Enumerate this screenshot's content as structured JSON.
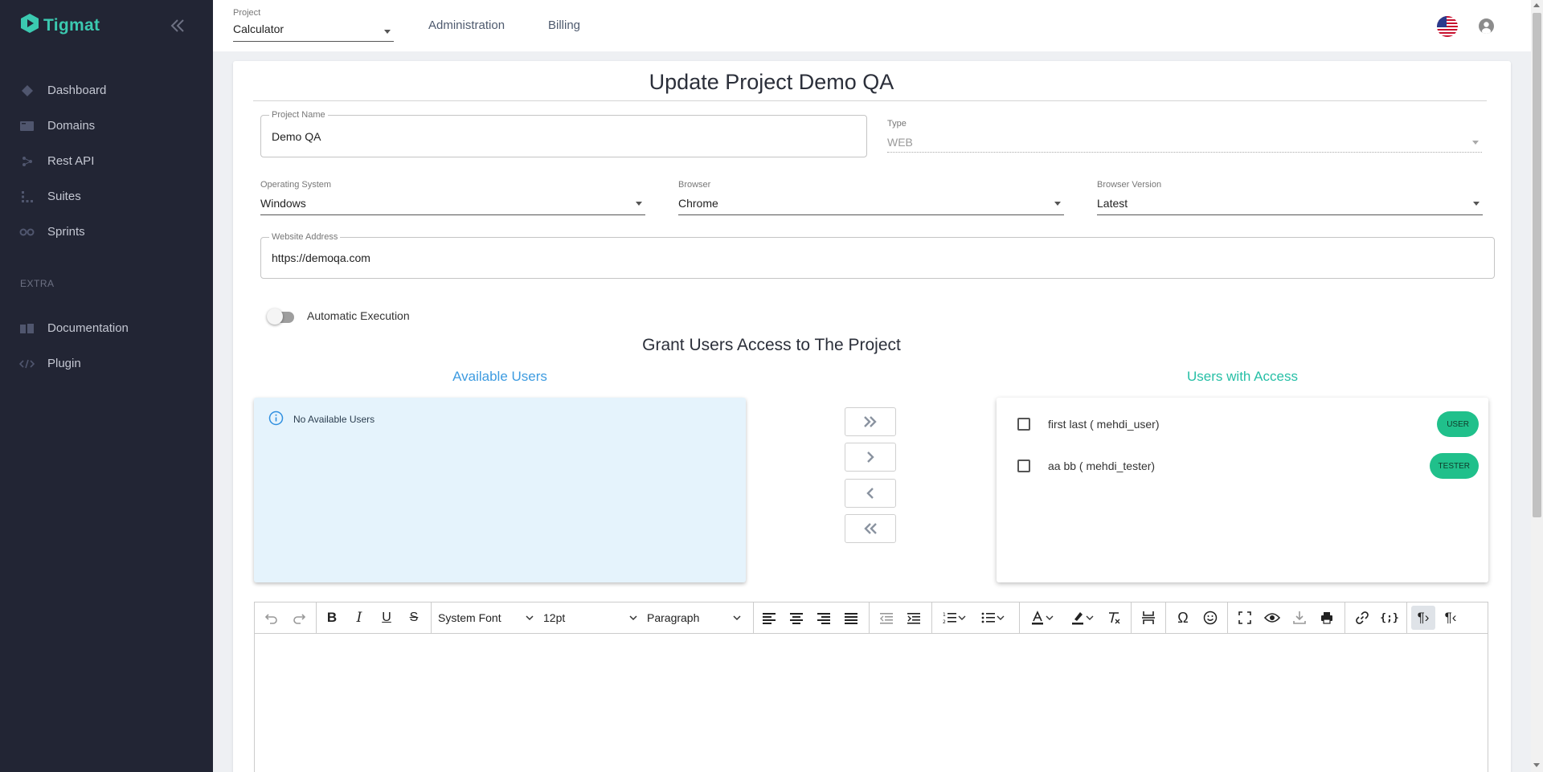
{
  "app": {
    "name": "Tigmat",
    "brand_color": "#3bc9b0"
  },
  "sidebar": {
    "items": [
      {
        "label": "Dashboard",
        "icon": "dashboard-icon"
      },
      {
        "label": "Domains",
        "icon": "domains-icon"
      },
      {
        "label": "Rest API",
        "icon": "rest-api-icon"
      },
      {
        "label": "Suites",
        "icon": "suites-icon"
      },
      {
        "label": "Sprints",
        "icon": "sprints-icon"
      }
    ],
    "extra_heading": "EXTRA",
    "extra_items": [
      {
        "label": "Documentation",
        "icon": "documentation-icon"
      },
      {
        "label": "Plugin",
        "icon": "code-icon"
      }
    ]
  },
  "topbar": {
    "project_label": "Project",
    "project_value": "Calculator",
    "links": [
      "Administration",
      "Billing"
    ]
  },
  "form": {
    "title": "Update Project Demo QA",
    "project_name": {
      "label": "Project Name",
      "value": "Demo QA"
    },
    "type": {
      "label": "Type",
      "value": "WEB"
    },
    "operating_system": {
      "label": "Operating System",
      "value": "Windows"
    },
    "browser": {
      "label": "Browser",
      "value": "Chrome"
    },
    "browser_version": {
      "label": "Browser Version",
      "value": "Latest"
    },
    "website_address": {
      "label": "Website Address",
      "value": "https://demoqa.com"
    },
    "automatic_execution": {
      "label": "Automatic Execution",
      "enabled": false
    }
  },
  "access": {
    "title": "Grant Users Access to The Project",
    "available_title": "Available Users",
    "available_title_color": "#3d9be0",
    "available_empty": "No Available Users",
    "with_access_title": "Users with Access",
    "with_access_title_color": "#26bfa6",
    "users": [
      {
        "name": "first last ( mehdi_user)",
        "role": "USER",
        "checked": false
      },
      {
        "name": "aa bb ( mehdi_tester)",
        "role": "TESTER",
        "checked": false
      }
    ]
  },
  "editor": {
    "font": "System Font",
    "size": "12pt",
    "block": "Paragraph"
  }
}
